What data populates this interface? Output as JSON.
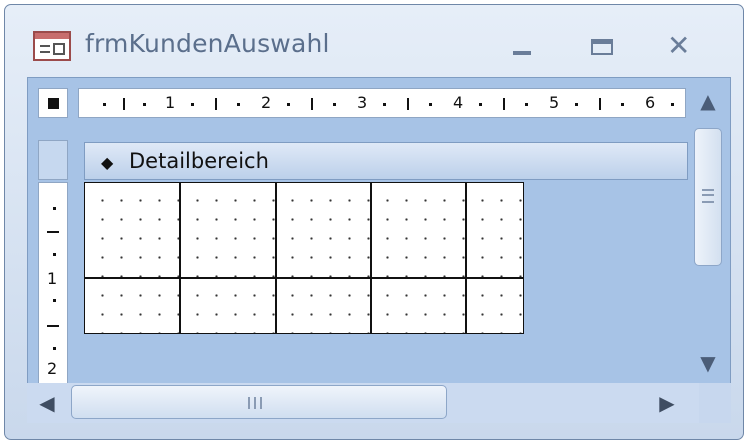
{
  "window": {
    "title": "frmKundenAuswahl",
    "minimize_icon": "minimize-icon",
    "maximize_icon": "maximize-icon",
    "close_icon": "close-icon",
    "close_glyph": "✕"
  },
  "ruler": {
    "horizontal_labels": [
      "1",
      "2",
      "3",
      "4",
      "5",
      "6"
    ],
    "vertical_labels": [
      "1",
      "2"
    ]
  },
  "section": {
    "label": "Detailbereich",
    "icon": "section-marker-icon",
    "icon_glyph": "◆"
  },
  "scrollbars": {
    "up_glyph": "▲",
    "down_glyph": "▼",
    "left_glyph": "◀",
    "right_glyph": "▶"
  },
  "colors": {
    "titlebar": "#dde7f4",
    "client": "#a7c3e6",
    "section_bar": "#cfdcf0",
    "grid": "#ffffff"
  }
}
